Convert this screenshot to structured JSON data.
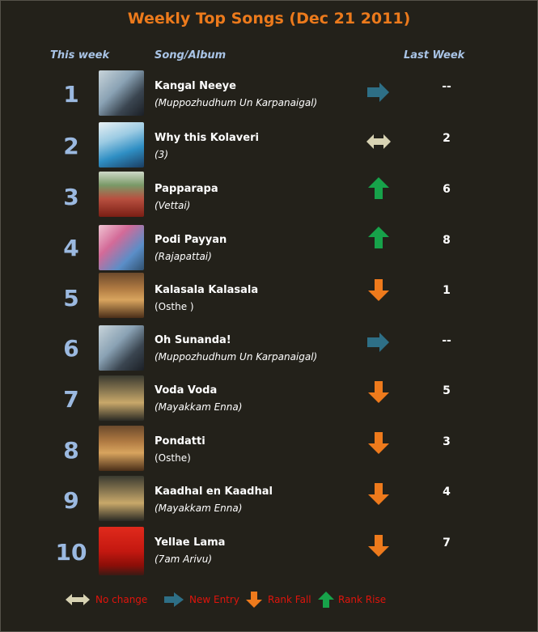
{
  "title": "Weekly Top Songs (Dec 21 2011)",
  "headers": {
    "this_week": "This week",
    "song_album": "Song/Album",
    "last_week": "Last Week"
  },
  "rows": [
    {
      "rank": "1",
      "song": "Kangal Neeye",
      "album": "(Muppozhudhum Un Karpanaigal)",
      "change": "new-entry",
      "last": "--"
    },
    {
      "rank": "2",
      "song": "Why this Kolaveri",
      "album": "(3)",
      "change": "no-change",
      "last": "2"
    },
    {
      "rank": "3",
      "song": "Papparapa",
      "album": "(Vettai)",
      "change": "rank-rise",
      "last": "6"
    },
    {
      "rank": "4",
      "song": "Podi Payyan",
      "album": "(Rajapattai)",
      "change": "rank-rise",
      "last": "8"
    },
    {
      "rank": "5",
      "song": "Kalasala Kalasala",
      "album": "(Osthe )",
      "change": "rank-fall",
      "last": "1"
    },
    {
      "rank": "6",
      "song": "Oh Sunanda!",
      "album": "(Muppozhudhum Un Karpanaigal)",
      "change": "new-entry",
      "last": "--"
    },
    {
      "rank": "7",
      "song": "Voda Voda",
      "album": "(Mayakkam Enna)",
      "change": "rank-fall",
      "last": "5"
    },
    {
      "rank": "8",
      "song": "Pondatti",
      "album": "(Osthe)",
      "change": "rank-fall",
      "last": "3"
    },
    {
      "rank": "9",
      "song": "Kaadhal en Kaadhal",
      "album": "(Mayakkam Enna)",
      "change": "rank-fall",
      "last": "4"
    },
    {
      "rank": "10",
      "song": "Yellae Lama",
      "album": "(7am Arivu)",
      "change": "rank-fall",
      "last": "7"
    }
  ],
  "legend": {
    "no_change": "No change",
    "new_entry": "New Entry",
    "rank_fall": "Rank Fall",
    "rank_rise": "Rank Rise"
  },
  "colors": {
    "title": "#ec7a1c",
    "rank": "#9bb9e0",
    "rise": "#17a24a",
    "fall": "#ee7a1c",
    "new_entry": "#2e6f86",
    "no_change": "#d8d3b3",
    "legend_text": "#e0140c"
  }
}
